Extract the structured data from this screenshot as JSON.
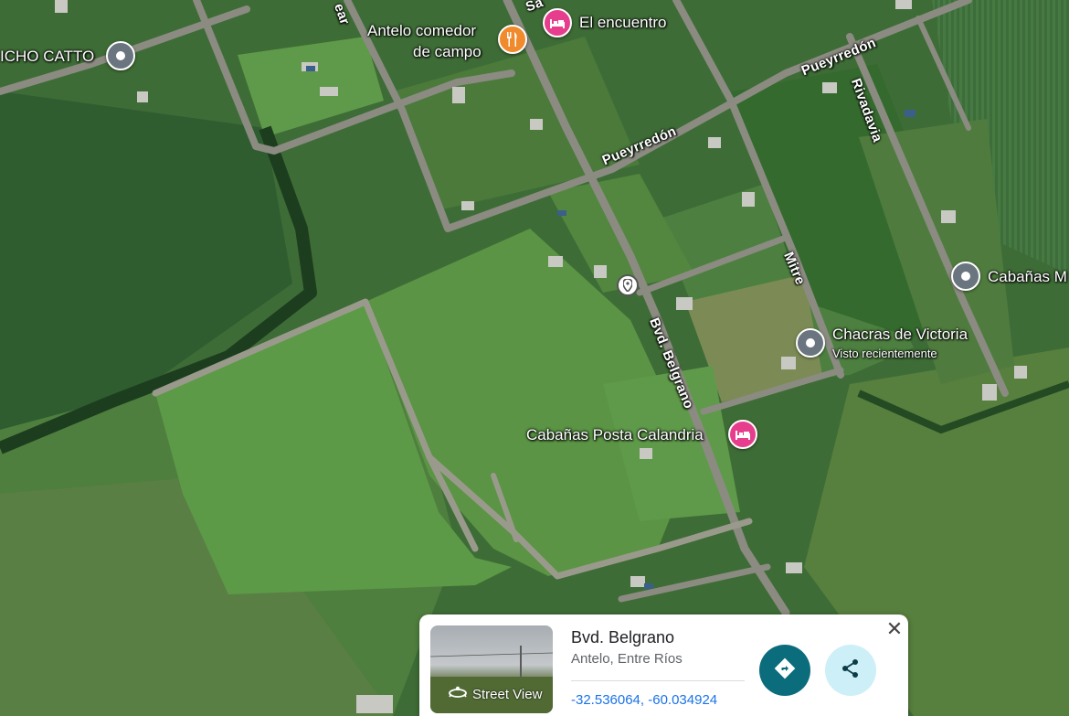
{
  "map": {
    "places": {
      "el_encuentro": "El encuentro",
      "antelo_comedor_line1": "Antelo comedor",
      "antelo_comedor_line2": "de campo",
      "rancho_catto": "ICHO CATTO",
      "cabanas_m": "Cabañas M",
      "chacras_de_victoria": "Chacras de Victoria",
      "chacras_sub": "Visto recientemente",
      "posta_calandria": "Cabañas Posta Calandria"
    },
    "streets": {
      "pueyrredon_1": "Pueyrredón",
      "pueyrredon_2": "Pueyrredón",
      "rivadavia": "Rivadavia",
      "mitre": "Mitre",
      "bvd_belgrano": "Bvd. Belgrano",
      "partial_top_left": "ear",
      "partial_top": "Sa"
    },
    "icons": {
      "place_pin": "place-pin-icon",
      "hotel": "hotel-icon",
      "restaurant": "restaurant-icon",
      "dropped_pin": "dropped-pin-icon"
    },
    "colors": {
      "hotel_pin": "#e63e8d",
      "restaurant_pin": "#f08a2c",
      "place_pin": "#6a7580",
      "road": "#8a8a80"
    }
  },
  "card": {
    "title": "Bvd. Belgrano",
    "subtitle": "Antelo, Entre Ríos",
    "coordinates": "-32.536064, -60.034924",
    "street_view_label": "Street View",
    "icons": {
      "street_view": "street-view-icon",
      "directions": "directions-icon",
      "share": "share-icon",
      "close": "close-icon"
    },
    "colors": {
      "directions_button": "#0b6c7c",
      "share_button": "#cdeff7",
      "link": "#1a73e8"
    }
  }
}
